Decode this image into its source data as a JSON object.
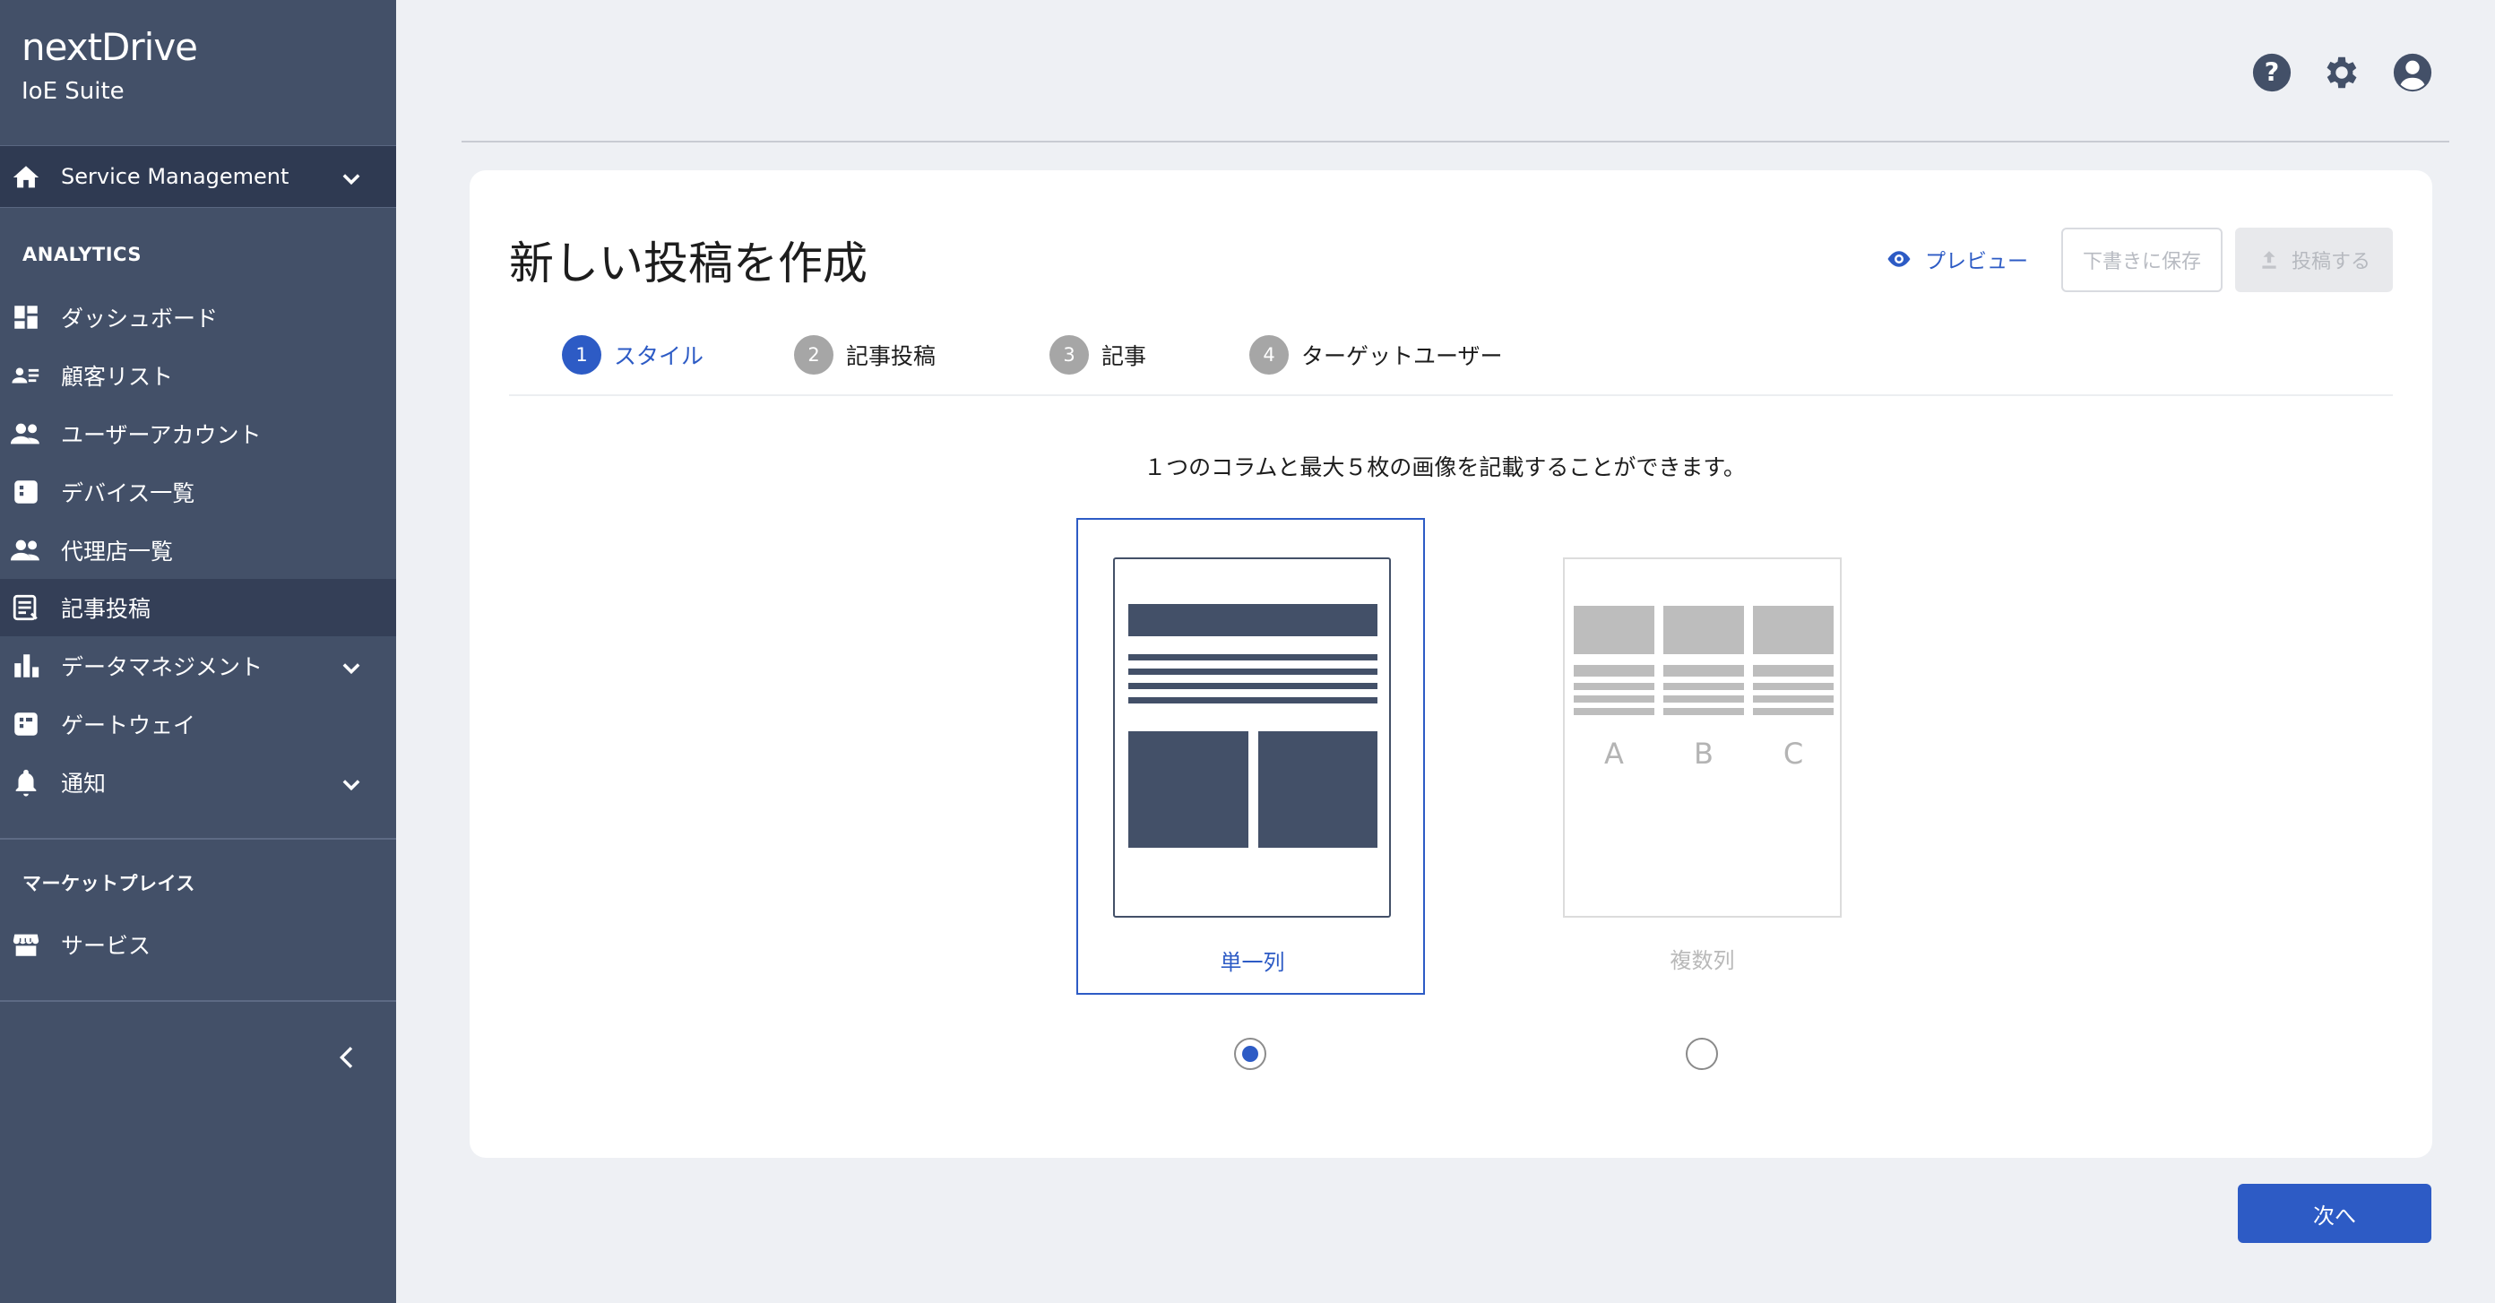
{
  "brand": {
    "logo": "nextDrive",
    "suite": "IoE Suite"
  },
  "sidebar": {
    "service_label": "Service Management",
    "analytics_header": "ANALYTICS",
    "items": [
      {
        "label": "ダッシュボード",
        "icon": "dashboard-icon"
      },
      {
        "label": "顧客リスト",
        "icon": "customer-list-icon"
      },
      {
        "label": "ユーザーアカウント",
        "icon": "user-accounts-icon"
      },
      {
        "label": "デバイス一覧",
        "icon": "device-list-icon"
      },
      {
        "label": "代理店一覧",
        "icon": "agency-list-icon"
      },
      {
        "label": "記事投稿",
        "icon": "article-post-icon"
      },
      {
        "label": "データマネジメント",
        "icon": "bar-chart-icon"
      },
      {
        "label": "ゲートウェイ",
        "icon": "gateway-icon"
      },
      {
        "label": "通知",
        "icon": "bell-icon"
      }
    ],
    "marketplace_header": "マーケットプレイス",
    "marketplace_items": [
      {
        "label": "サービス",
        "icon": "store-icon"
      }
    ]
  },
  "header": {
    "icons": [
      "help-icon",
      "gear-icon",
      "account-icon"
    ]
  },
  "page": {
    "title": "新しい投稿を作成",
    "preview_label": "プレビュー",
    "draft_label": "下書きに保存",
    "post_label": "投稿する",
    "steps": [
      {
        "num": "1",
        "label": "スタイル"
      },
      {
        "num": "2",
        "label": "記事投稿"
      },
      {
        "num": "3",
        "label": "記事"
      },
      {
        "num": "4",
        "label": "ターゲットユーザー"
      }
    ],
    "instruction": "１つのコラムと最大５枚の画像を記載することができます。",
    "options": [
      {
        "label": "単一列",
        "selected": true
      },
      {
        "label": "複数列",
        "selected": false
      }
    ],
    "column_letters": [
      "A",
      "B",
      "C"
    ],
    "next_label": "次へ"
  },
  "colors": {
    "accent": "#2d5bc5",
    "sidebar": "#435068",
    "sidebar_active": "#343f57"
  }
}
